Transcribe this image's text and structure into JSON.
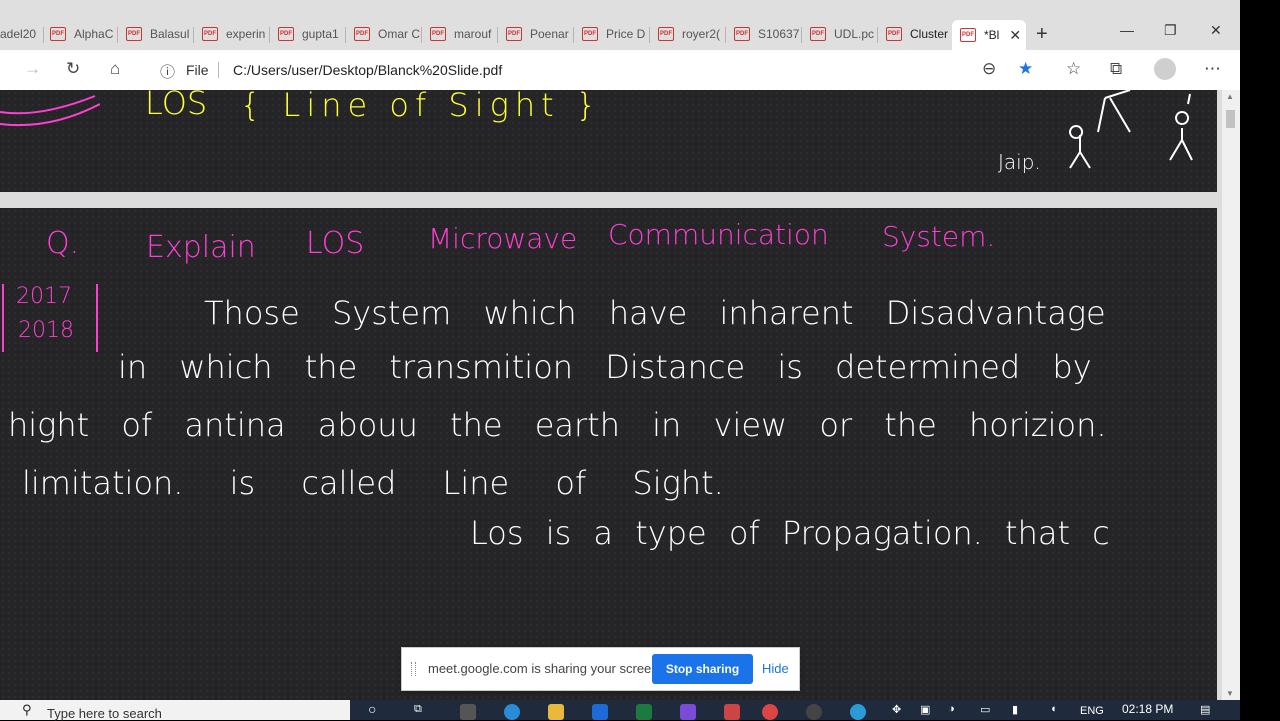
{
  "tabs": [
    {
      "label": "adel20"
    },
    {
      "label": "AlphaC"
    },
    {
      "label": "Balasul"
    },
    {
      "label": "experin"
    },
    {
      "label": "gupta1"
    },
    {
      "label": "Omar C"
    },
    {
      "label": "marouf"
    },
    {
      "label": "Poenar"
    },
    {
      "label": "Price D"
    },
    {
      "label": "royer2("
    },
    {
      "label": "S10637"
    },
    {
      "label": "UDL.pc"
    },
    {
      "label": "Cluster"
    },
    {
      "label": "*Bl"
    }
  ],
  "address_bar": {
    "file_label": "File",
    "url": "C:/Users/user/Desktop/Blanck%20Slide.pdf"
  },
  "page1": {
    "heading_pink": "LOS",
    "heading_yellow": "{ Line of Sight }",
    "name": "Jaip."
  },
  "page2": {
    "question_mark": "Q.",
    "question": [
      "Explain",
      "LOS",
      "Microwave",
      "Communication",
      "System."
    ],
    "years": [
      "2017",
      "2018"
    ],
    "lines": [
      "Those System which have inharent Disadvantage",
      "in which the transmition Distance is determined by",
      "hight of antina abouu the earth in view or the horizion.",
      "limitation. is called Line of Sight.",
      "Los is a type of Propagation. that c"
    ]
  },
  "share_bar": {
    "message": "meet.google.com is sharing your screen.",
    "stop_label": "Stop sharing",
    "hide_label": "Hide"
  },
  "taskbar": {
    "search_placeholder": "Type here to search",
    "lang": "ENG",
    "time": "02:18 PM"
  }
}
